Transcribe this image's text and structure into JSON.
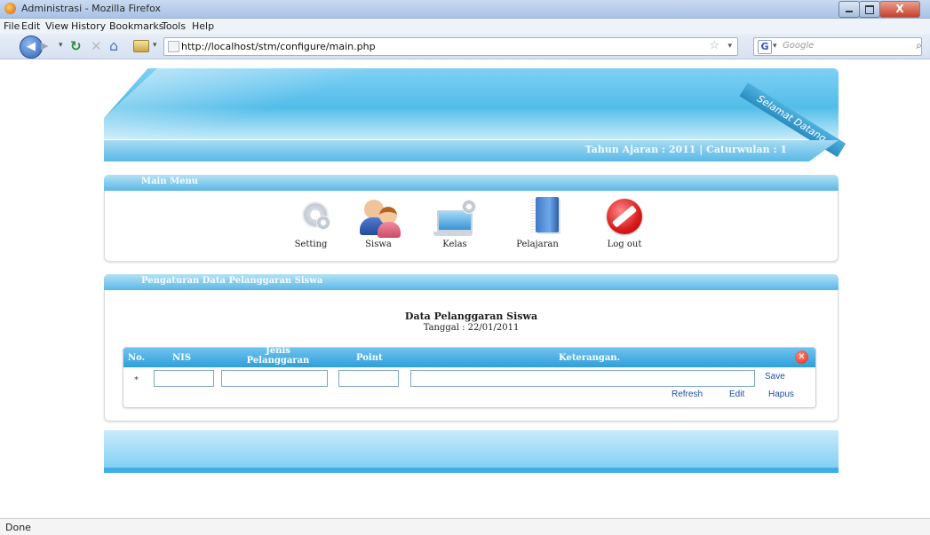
{
  "window": {
    "title": "Administrasi - Mozilla Firefox",
    "close_label": "X"
  },
  "menubar": [
    "File",
    "Edit",
    "View",
    "History",
    "Bookmarks",
    "Tools",
    "Help"
  ],
  "toolbar": {
    "url": "http://localhost/stm/configure/main.php",
    "search_placeholder": "Google",
    "search_engine_label": "G"
  },
  "banner": {
    "ribbon": "Selamat Datang.",
    "year_info": "Tahun Ajaran : 2011 | Caturwulan : 1"
  },
  "main_menu": {
    "title": "Main Menu",
    "items": [
      {
        "label": "Setting",
        "icon": "gear-icon"
      },
      {
        "label": "Siswa",
        "icon": "users-icon"
      },
      {
        "label": "Kelas",
        "icon": "laptop-icon"
      },
      {
        "label": "Pelajaran",
        "icon": "book-icon"
      },
      {
        "label": "Log out",
        "icon": "logout-icon"
      }
    ]
  },
  "violation": {
    "section_title": "Pengaturan Data Pelanggaran Siswa",
    "heading": "Data Pelanggaran Siswa",
    "date_line": "Tanggal : 22/01/2011",
    "columns": [
      "No.",
      "NIS",
      "Jenis Pelanggaran",
      "Point",
      "Keterangan."
    ],
    "row_marker": "*",
    "inputs": {
      "nis": "",
      "jenis": "",
      "point": "",
      "keterangan": ""
    },
    "actions": {
      "save": "Save",
      "refresh": "Refresh",
      "edit": "Edit",
      "delete": "Hapus"
    }
  },
  "statusbar": {
    "text": "Done"
  }
}
